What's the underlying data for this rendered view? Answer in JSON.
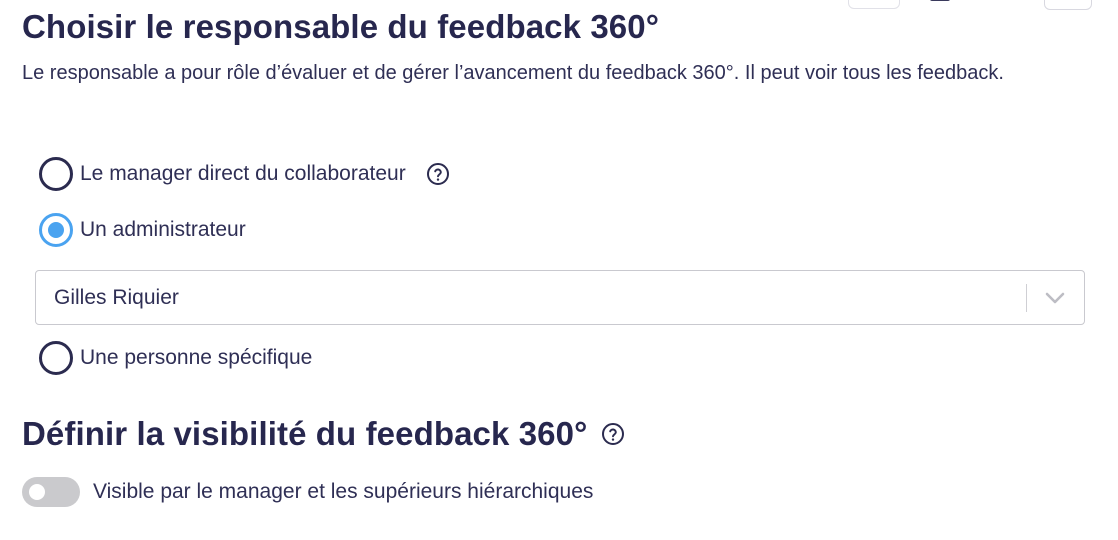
{
  "section_owner": {
    "title": "Choisir le responsable du feedback 360°",
    "description": "Le responsable a pour rôle d’évaluer et de gérer l’avancement du feedback 360°. Il peut voir tous les feedback.",
    "options": [
      {
        "label": "Le manager direct du collaborateur",
        "checked": false,
        "has_help": true
      },
      {
        "label": "Un administrateur",
        "checked": true
      },
      {
        "label": "Une personne spécifique",
        "checked": false
      }
    ],
    "admin_select": {
      "value": "Gilles Riquier"
    }
  },
  "section_visibility": {
    "title": "Définir la visibilité du feedback 360°",
    "toggle": {
      "label": "Visible par le manager et les supérieurs hiérarchiques",
      "on": false
    }
  },
  "icons": {
    "help": "help-circle-icon",
    "chevron": "chevron-down-icon"
  },
  "colors": {
    "text": "#2f2f55",
    "title": "#27274e",
    "radio_checked": "#4aa3f0",
    "toggle_off": "#cacacd"
  }
}
